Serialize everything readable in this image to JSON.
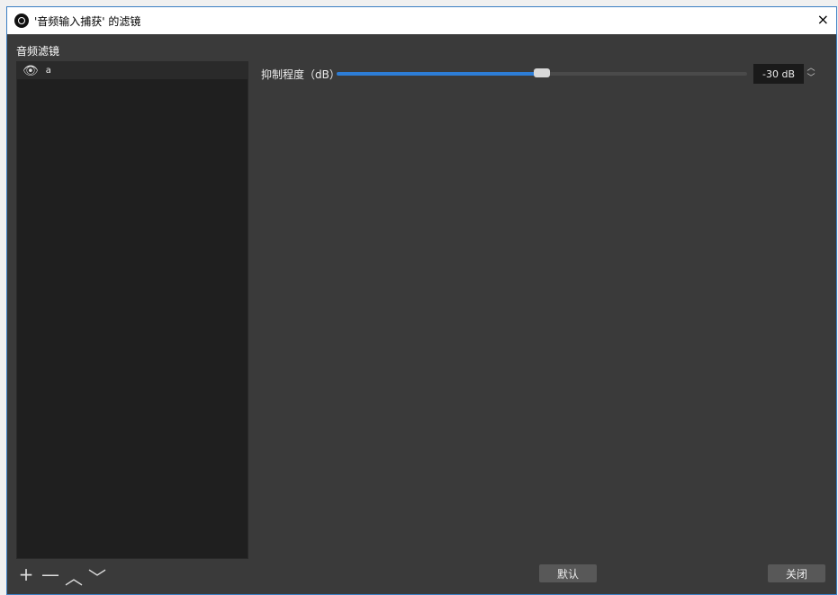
{
  "window": {
    "title": "'音频输入捕获' 的滤镜",
    "close_icon": "×"
  },
  "filters": {
    "label": "音频滤镜",
    "items": [
      {
        "name": "a",
        "visible": true
      }
    ],
    "tools": {
      "add": "+",
      "remove": "—",
      "up": "︿",
      "down": "﹀"
    }
  },
  "params": {
    "suppression": {
      "label": "抑制程度（dB）",
      "value_text": "-30 dB",
      "value": -30,
      "min": -60,
      "max": 0
    }
  },
  "buttons": {
    "defaults": "默认",
    "close": "关闭"
  },
  "colors": {
    "accent": "#2d7dd6"
  }
}
